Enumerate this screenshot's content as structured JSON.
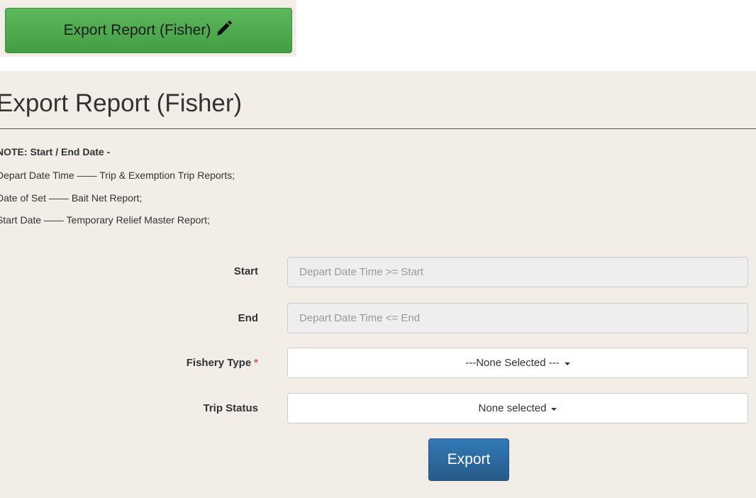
{
  "top_button": {
    "label": "Export Report (Fisher)",
    "icon": "pencil-icon"
  },
  "page": {
    "title": "Export Report (Fisher)"
  },
  "note": {
    "heading": "NOTE: Start / End Date -",
    "lines": [
      "Depart Date Time —— Trip & Exemption Trip Reports;",
      "Date of Set —— Bait Net Report;",
      "Start Date —— Temporary Relief Master Report;"
    ]
  },
  "form": {
    "start": {
      "label": "Start",
      "placeholder": "Depart Date Time >= Start"
    },
    "end": {
      "label": "End",
      "placeholder": "Depart Date Time <= End"
    },
    "fishery_type": {
      "label": "Fishery Type",
      "required_mark": "*",
      "selected": "---None Selected ---"
    },
    "trip_status": {
      "label": "Trip Status",
      "selected": "None selected"
    },
    "export_label": "Export"
  },
  "colors": {
    "panel_bg": "#f2ede6",
    "success": "#5cb85c",
    "primary": "#337ab7",
    "required": "#d9534f"
  }
}
